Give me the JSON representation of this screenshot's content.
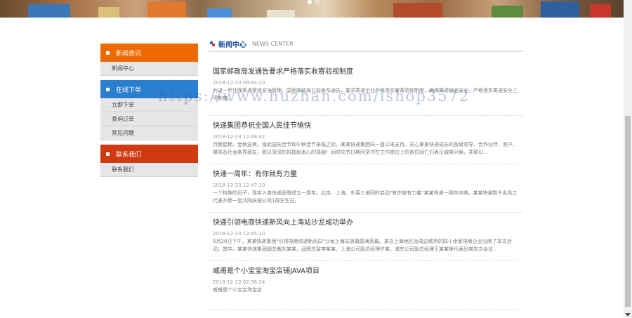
{
  "sidebar": {
    "groups": [
      {
        "title": "新闻资讯",
        "items": [
          "新闻中心"
        ]
      },
      {
        "title": "在线下单",
        "items": [
          "立即下单",
          "查询订单",
          "常见问题"
        ]
      },
      {
        "title": "联系我们",
        "items": [
          "联系我们"
        ]
      }
    ]
  },
  "main": {
    "title": "新闻中心",
    "subtitle": "NEWS CENTER",
    "news": [
      {
        "title": "国家邮政局发通告要求严格落实收寄验视制度",
        "date": "2018-12-23 09:44:20",
        "summary": "为进一步加强寄递渠道安全管理，国家邮政局日前发布通告，要求寄递企业严格落实收寄验视制度，确保寄递物品安全。严格落实寄递安全三项制度。"
      },
      {
        "title": "快递集团恭祝全国人民佳节愉快",
        "date": "2018-12-23 12:48:42",
        "summary": "月朗星稀，金秋送爽。值此国庆佳节和中秋佳节来临之际，某某快递集团向一直以来支持、关心某某快递成长的各级领导、合作伙伴、客户、媒体及社会各界朋友，致以深深的祝福和衷心的感谢！同时向节日期间坚守在工作岗位上的各位同仁们表示诚挚问候，并致以..."
      },
      {
        "title": "快递一周年：有你就有力量",
        "date": "2018-12-23 12:47:10",
        "summary": "一个特殊的日子，现实入夜快递品牌成立一周年。北京、上海、东莞三地同时启动\"有你就有力量\"某某快递一周年庆典，某某快递数千名员工代表齐聚一堂共同庆祝公司1周岁生日。"
      },
      {
        "title": "快递引领电商快递新风向上海站沙龙成功举办",
        "date": "2018-12-23 12:45:10",
        "summary": "8月20日下午，某某快递集团\"引领电商快递新风向\"沙龙上海站落幕圆满落幕。来自上海地区及周边城市的四十余家电商企业出席了本次活动，其中，某某快递集团副总裁刘某某、品牌总监李某某、上海公司副总经理许某、浦东公司副总经理王某某等代表出席本次会议..."
      },
      {
        "title": "威甫是个小宝宝淘宝店铺JAVA项目",
        "date": "2018-12-22 02:36:24",
        "summary": "威甫是个小宝宝淘宝店"
      }
    ]
  },
  "watermark": "https://www.huzhan.com/ishop3572",
  "colors": {
    "accent_orange": "#ee6a00",
    "accent_blue": "#2b7fd0",
    "accent_red": "#d03a12",
    "title_blue": "#1a4f9c"
  }
}
